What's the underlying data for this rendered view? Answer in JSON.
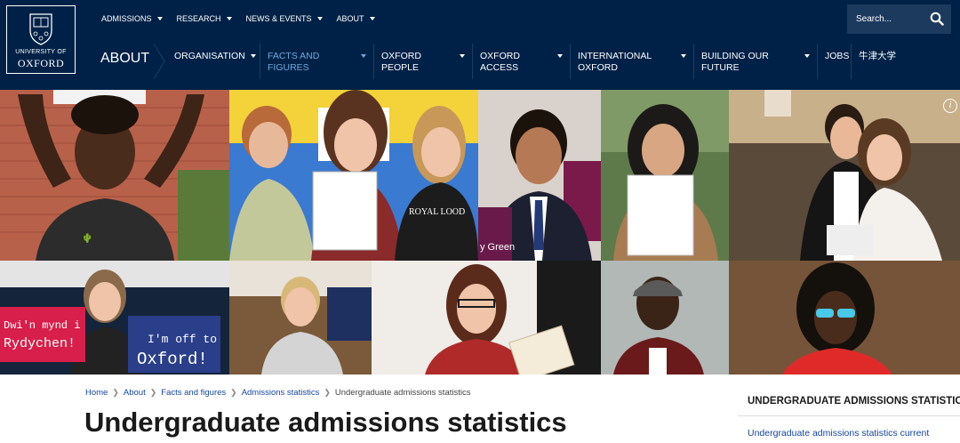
{
  "brand": {
    "line1": "UNIVERSITY OF",
    "line2": "OXFORD",
    "primary_color": "#002147",
    "accent_color": "#6fa8dc"
  },
  "top_nav": [
    {
      "label": "ADMISSIONS",
      "has_dropdown": true
    },
    {
      "label": "RESEARCH",
      "has_dropdown": true
    },
    {
      "label": "NEWS & EVENTS",
      "has_dropdown": true
    },
    {
      "label": "ABOUT",
      "has_dropdown": true
    }
  ],
  "search": {
    "placeholder": "Search...",
    "icon": "search-icon"
  },
  "section": {
    "title": "ABOUT"
  },
  "main_nav": [
    {
      "label": "ORGANISATION",
      "has_dropdown": true,
      "active": false
    },
    {
      "label": "FACTS AND FIGURES",
      "has_dropdown": true,
      "active": true
    },
    {
      "label": "OXFORD PEOPLE",
      "has_dropdown": true,
      "active": false
    },
    {
      "label": "OXFORD ACCESS",
      "has_dropdown": true,
      "active": false
    },
    {
      "label": "INTERNATIONAL OXFORD",
      "has_dropdown": true,
      "active": false
    },
    {
      "label": "BUILDING OUR FUTURE",
      "has_dropdown": true,
      "active": false
    },
    {
      "label": "JOBS",
      "has_dropdown": false,
      "active": false
    },
    {
      "label": "牛津大学",
      "has_dropdown": false,
      "active": false
    }
  ],
  "hero": {
    "info_icon": "info-icon",
    "sign_welsh_1": "Dwi'n mynd i",
    "sign_welsh_2": "Rydychen!",
    "sign_english_1": "I'm off to",
    "sign_english_2": "Oxford!",
    "shirt_text": "ROYAL LOOD",
    "poster_text": "y Green"
  },
  "breadcrumbs": [
    {
      "label": "Home",
      "link": true
    },
    {
      "label": "About",
      "link": true
    },
    {
      "label": "Facts and figures",
      "link": true
    },
    {
      "label": "Admissions statistics",
      "link": true
    },
    {
      "label": "Undergraduate admissions statistics",
      "link": false
    }
  ],
  "page": {
    "title": "Undergraduate admissions statistics"
  },
  "sidebar": {
    "title": "UNDERGRADUATE ADMISSIONS STATISTICS",
    "links": [
      "Undergraduate admissions statistics current"
    ]
  }
}
